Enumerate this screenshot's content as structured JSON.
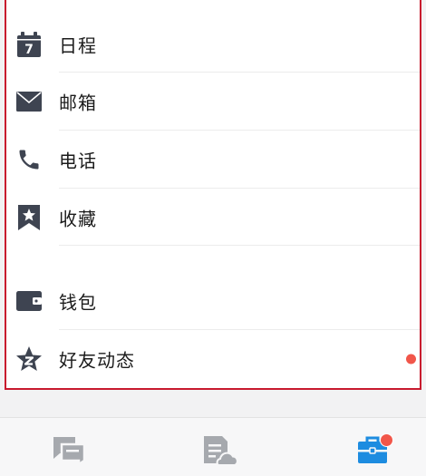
{
  "menu": {
    "items": [
      {
        "label": "日程",
        "icon": "calendar-icon",
        "badge": "7"
      },
      {
        "label": "邮箱",
        "icon": "mail-icon"
      },
      {
        "label": "电话",
        "icon": "phone-icon"
      },
      {
        "label": "收藏",
        "icon": "bookmark-star-icon"
      },
      {
        "label": "钱包",
        "icon": "wallet-icon"
      },
      {
        "label": "好友动态",
        "icon": "friends-star-icon",
        "unread_dot": true
      }
    ]
  },
  "tabbar": {
    "tabs": [
      {
        "icon": "messages-icon",
        "active": false
      },
      {
        "icon": "documents-cloud-icon",
        "active": false
      },
      {
        "icon": "briefcase-icon",
        "active": true,
        "badge_dot": true
      }
    ]
  },
  "colors": {
    "icon_gray": "#3e4451",
    "active_blue": "#1d8ce0",
    "badge_red": "#f1564a",
    "highlight_border": "#c8192e"
  }
}
